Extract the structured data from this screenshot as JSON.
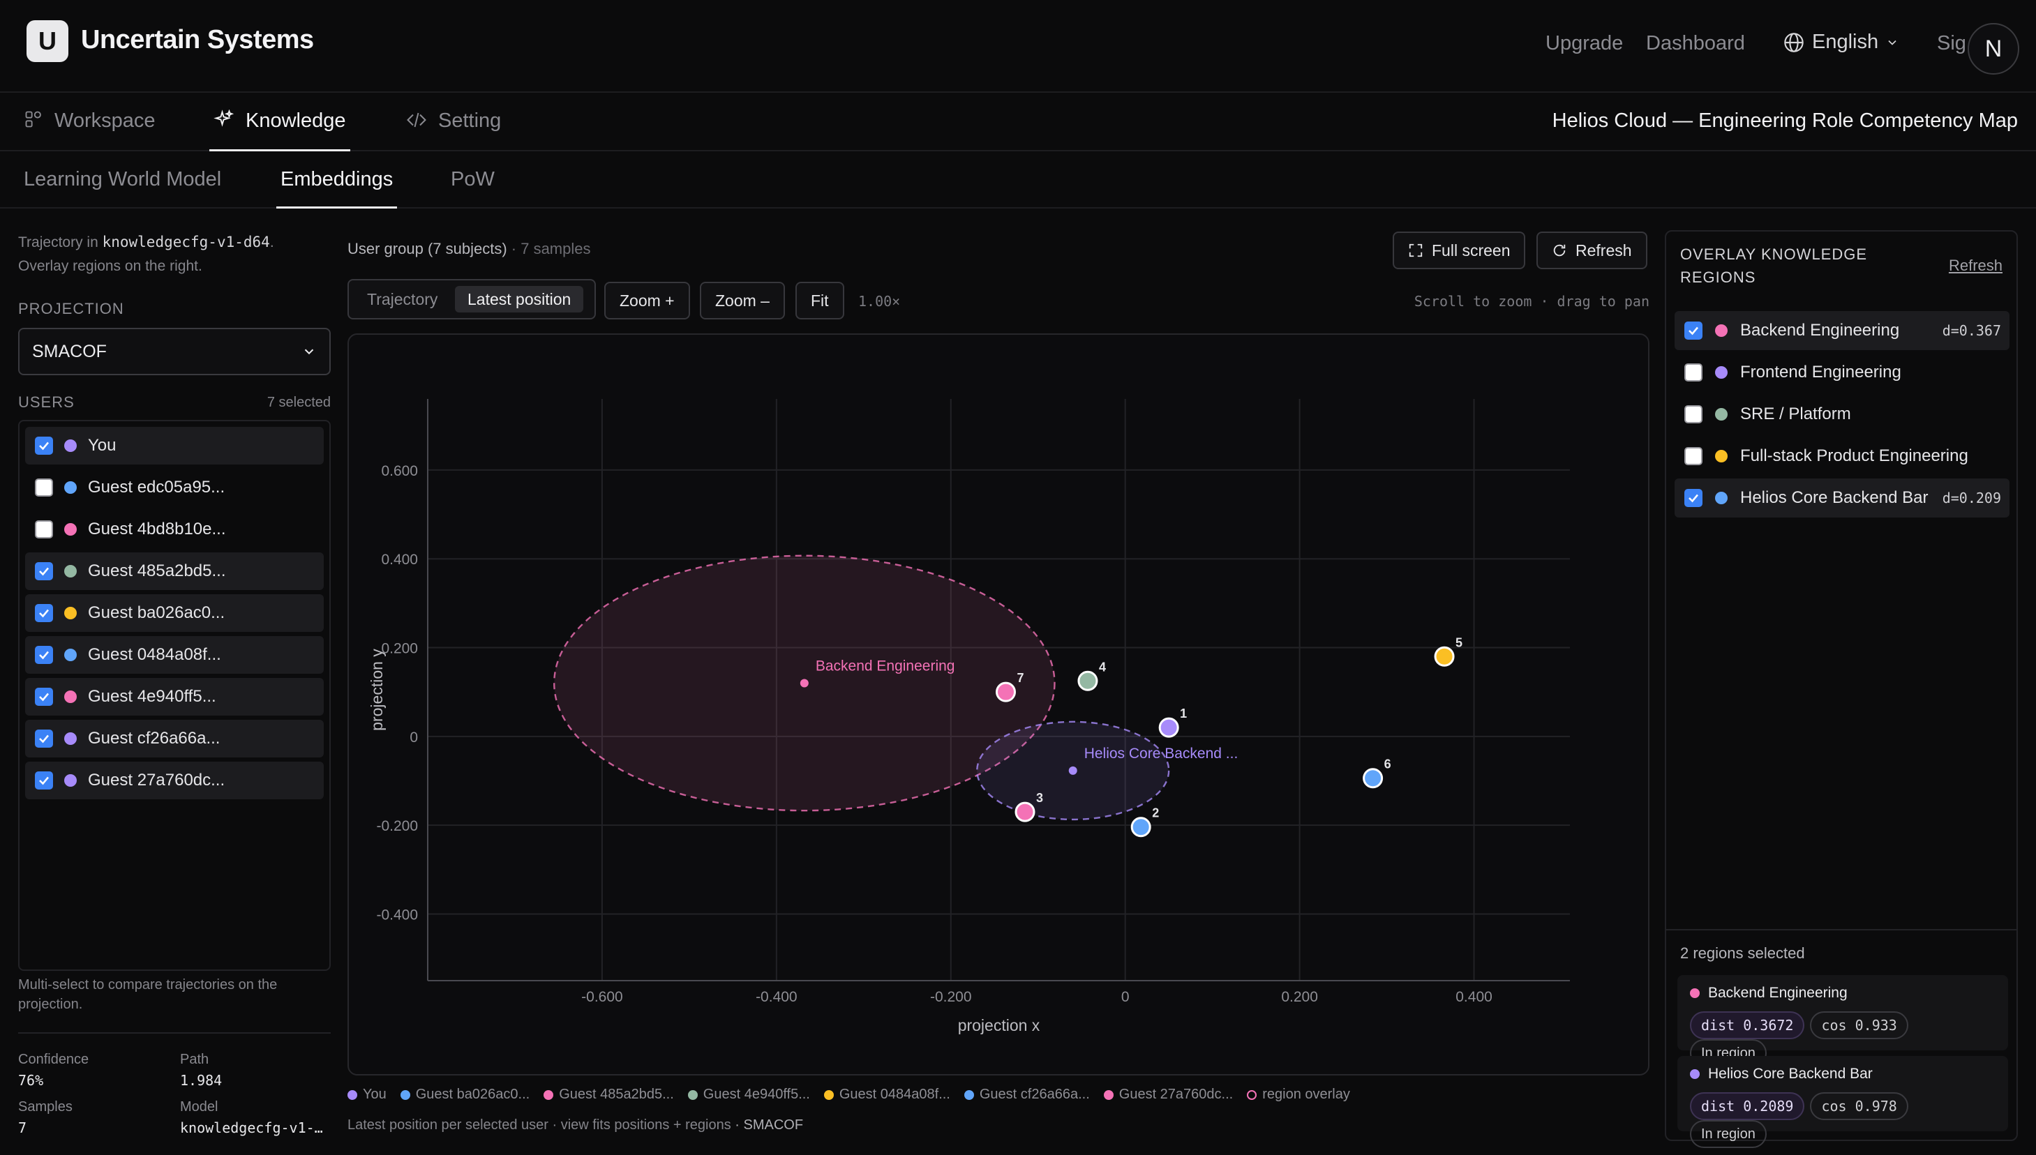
{
  "app": {
    "brand": "Uncertain Systems",
    "logo_letter": "U",
    "avatar_letter": "N"
  },
  "topnav": {
    "upgrade": "Upgrade",
    "dashboard": "Dashboard",
    "language": "English",
    "signin": "Sig"
  },
  "nav": {
    "tabs": [
      "Workspace",
      "Knowledge",
      "Setting"
    ],
    "active": "Knowledge",
    "page_title": "Helios Cloud — Engineering Role Competency Map"
  },
  "subnav": {
    "tabs": [
      "Learning World Model",
      "Embeddings",
      "PoW"
    ],
    "active": "Embeddings"
  },
  "left": {
    "intro_prefix": "Trajectory in ",
    "intro_code": "knowledgecfg-v1-d64",
    "intro_suffix": ".",
    "intro_line2": "Overlay regions on the right.",
    "projection_label": "PROJECTION",
    "projection_value": "SMACOF",
    "users_label": "USERS",
    "users_count": "7 selected",
    "users": [
      {
        "name": "You",
        "checked": true,
        "color": "#a78bfa"
      },
      {
        "name": "Guest edc05a95...",
        "checked": false,
        "color": "#60a5fa"
      },
      {
        "name": "Guest 4bd8b10e...",
        "checked": false,
        "color": "#f472b6"
      },
      {
        "name": "Guest 485a2bd5...",
        "checked": true,
        "color": "#94b8a3"
      },
      {
        "name": "Guest ba026ac0...",
        "checked": true,
        "color": "#fbbf24"
      },
      {
        "name": "Guest 0484a08f...",
        "checked": true,
        "color": "#60a5fa"
      },
      {
        "name": "Guest 4e940ff5...",
        "checked": true,
        "color": "#f472b6"
      },
      {
        "name": "Guest cf26a66a...",
        "checked": true,
        "color": "#a78bfa"
      },
      {
        "name": "Guest 27a760dc...",
        "checked": true,
        "color": "#a78bfa"
      }
    ],
    "hint": "Multi-select to compare trajectories on the projection.",
    "stats": {
      "confidence_label": "Confidence",
      "confidence": "76%",
      "path_label": "Path",
      "path": "1.984",
      "samples_label": "Samples",
      "samples": "7",
      "model_label": "Model",
      "model": "knowledgecfg-v1-…"
    }
  },
  "center": {
    "group_label": "User group (7 subjects)",
    "samples_label": "· 7 samples",
    "fullscreen": "Full screen",
    "refresh": "Refresh",
    "mode_tabs": [
      "Trajectory",
      "Latest position"
    ],
    "mode_active": "Latest position",
    "zoom_in": "Zoom +",
    "zoom_out": "Zoom –",
    "fit": "Fit",
    "zoom_level": "1.00×",
    "hint": "Scroll to zoom · drag to pan",
    "footer": "Latest position per selected user · view fits positions + regions",
    "footer_method": "· SMACOF",
    "legend": [
      {
        "label": "You",
        "color": "#a78bfa"
      },
      {
        "label": "Guest ba026ac0...",
        "color": "#60a5fa"
      },
      {
        "label": "Guest 485a2bd5...",
        "color": "#f472b6"
      },
      {
        "label": "Guest 4e940ff5...",
        "color": "#94b8a3"
      },
      {
        "label": "Guest 0484a08f...",
        "color": "#fbbf24"
      },
      {
        "label": "Guest cf26a66a...",
        "color": "#60a5fa"
      },
      {
        "label": "Guest 27a760dc...",
        "color": "#f472b6"
      },
      {
        "label": "region overlay",
        "color": "ring"
      }
    ]
  },
  "chart_data": {
    "type": "scatter",
    "xlabel": "projection x",
    "ylabel": "projection y",
    "xlim": [
      -0.8,
      0.51
    ],
    "ylim": [
      -0.55,
      0.76
    ],
    "xticks": [
      -0.6,
      -0.4,
      -0.2,
      0,
      0.2,
      0.4
    ],
    "yticks": [
      -0.4,
      -0.2,
      0,
      0.2,
      0.4,
      0.6
    ],
    "xtick_labels": [
      "-0.600",
      "-0.400",
      "-0.200",
      "0",
      "0.200",
      "0.400"
    ],
    "ytick_labels": [
      "-0.400",
      "-0.200",
      "0",
      "0.200",
      "0.400",
      "0.600"
    ],
    "grid": true,
    "points": [
      {
        "label": "1",
        "x": 0.05,
        "y": 0.02,
        "color": "#a78bfa"
      },
      {
        "label": "2",
        "x": 0.018,
        "y": -0.204,
        "color": "#60a5fa"
      },
      {
        "label": "3",
        "x": -0.115,
        "y": -0.17,
        "color": "#f472b6"
      },
      {
        "label": "4",
        "x": -0.043,
        "y": 0.125,
        "color": "#94b8a3"
      },
      {
        "label": "5",
        "x": 0.366,
        "y": 0.18,
        "color": "#fbbf24"
      },
      {
        "label": "6",
        "x": 0.284,
        "y": -0.094,
        "color": "#60a5fa"
      },
      {
        "label": "7",
        "x": -0.137,
        "y": 0.1,
        "color": "#f472b6"
      }
    ],
    "regions": [
      {
        "label": "Backend Engineering",
        "cx": -0.368,
        "cy": 0.12,
        "r": 0.287,
        "color": "#f472b6"
      },
      {
        "label": "Helios Core Backend ...",
        "cx": -0.06,
        "cy": -0.077,
        "r": 0.11,
        "color": "#a78bfa"
      }
    ]
  },
  "right": {
    "title": "OVERLAY KNOWLEDGE REGIONS",
    "refresh": "Refresh",
    "regions": [
      {
        "name": "Backend Engineering",
        "checked": true,
        "color": "#f472b6",
        "d": "d=0.367"
      },
      {
        "name": "Frontend Engineering",
        "checked": false,
        "color": "#a78bfa",
        "d": ""
      },
      {
        "name": "SRE / Platform",
        "checked": false,
        "color": "#94b8a3",
        "d": ""
      },
      {
        "name": "Full-stack Product Engineering",
        "checked": false,
        "color": "#fbbf24",
        "d": ""
      },
      {
        "name": "Helios Core Backend Bar",
        "checked": true,
        "color": "#60a5fa",
        "d": "d=0.209"
      }
    ],
    "selected_count": "2 regions selected",
    "cards": [
      {
        "name": "Backend Engineering",
        "color": "#f472b6",
        "dist": "dist 0.3672",
        "cos": "cos 0.933",
        "status": "In region"
      },
      {
        "name": "Helios Core Backend Bar",
        "color": "#a78bfa",
        "dist": "dist 0.2089",
        "cos": "cos 0.978",
        "status": "In region"
      }
    ]
  }
}
